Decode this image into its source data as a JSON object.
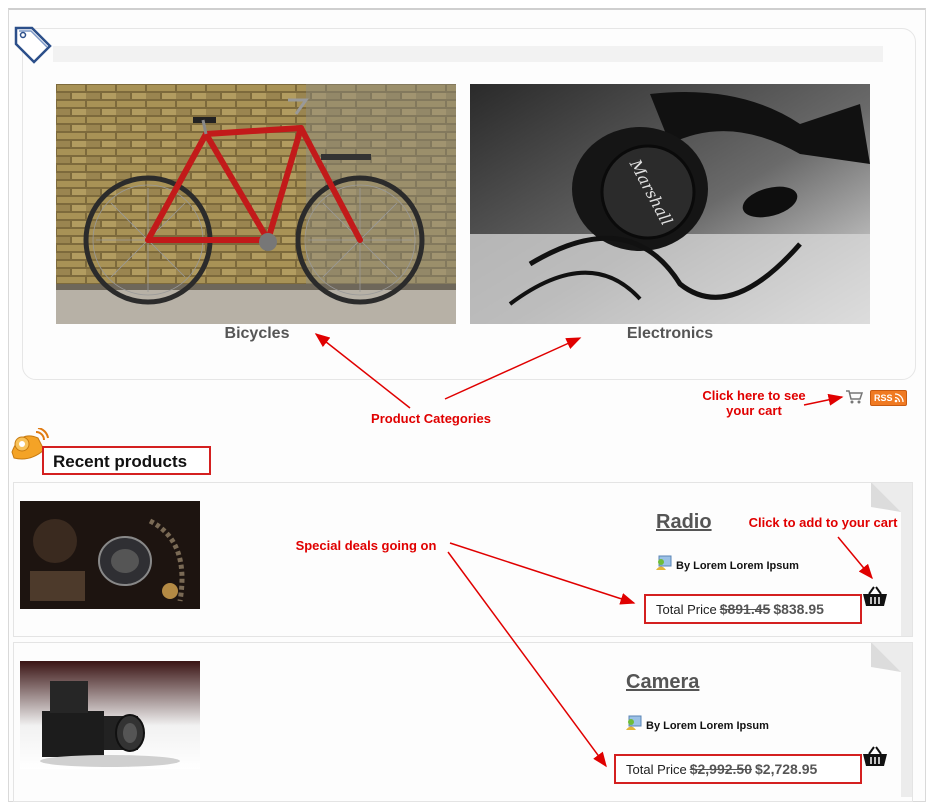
{
  "categories": [
    {
      "label": "Bicycles",
      "image": "bicycle-photo"
    },
    {
      "label": "Electronics",
      "image": "headphones-photo"
    }
  ],
  "cart_link": {
    "icon": "cart-icon"
  },
  "rss": {
    "label": "RSS",
    "icon": "rss-icon"
  },
  "recent": {
    "title": "Recent products"
  },
  "products": [
    {
      "name": "Radio",
      "author": "By Lorem Lorem Ipsum",
      "price_label": "Total Price",
      "old_price": "$891.45",
      "new_price": "$838.95",
      "add_icon": "basket-icon"
    },
    {
      "name": "Camera",
      "author": "By Lorem Lorem Ipsum",
      "price_label": "Total Price",
      "old_price": "$2,992.50",
      "new_price": "$2,728.95",
      "add_icon": "basket-icon"
    }
  ],
  "annotations": {
    "product_categories": "Product Categories",
    "cart_line1": "Click here to see",
    "cart_line2": "your cart",
    "add_to_cart": "Click to add to your cart",
    "special_deals": "Special deals going on"
  },
  "colors": {
    "annotation": "#e00000",
    "highlight_box": "#d42020",
    "rss": "#f07a22"
  }
}
